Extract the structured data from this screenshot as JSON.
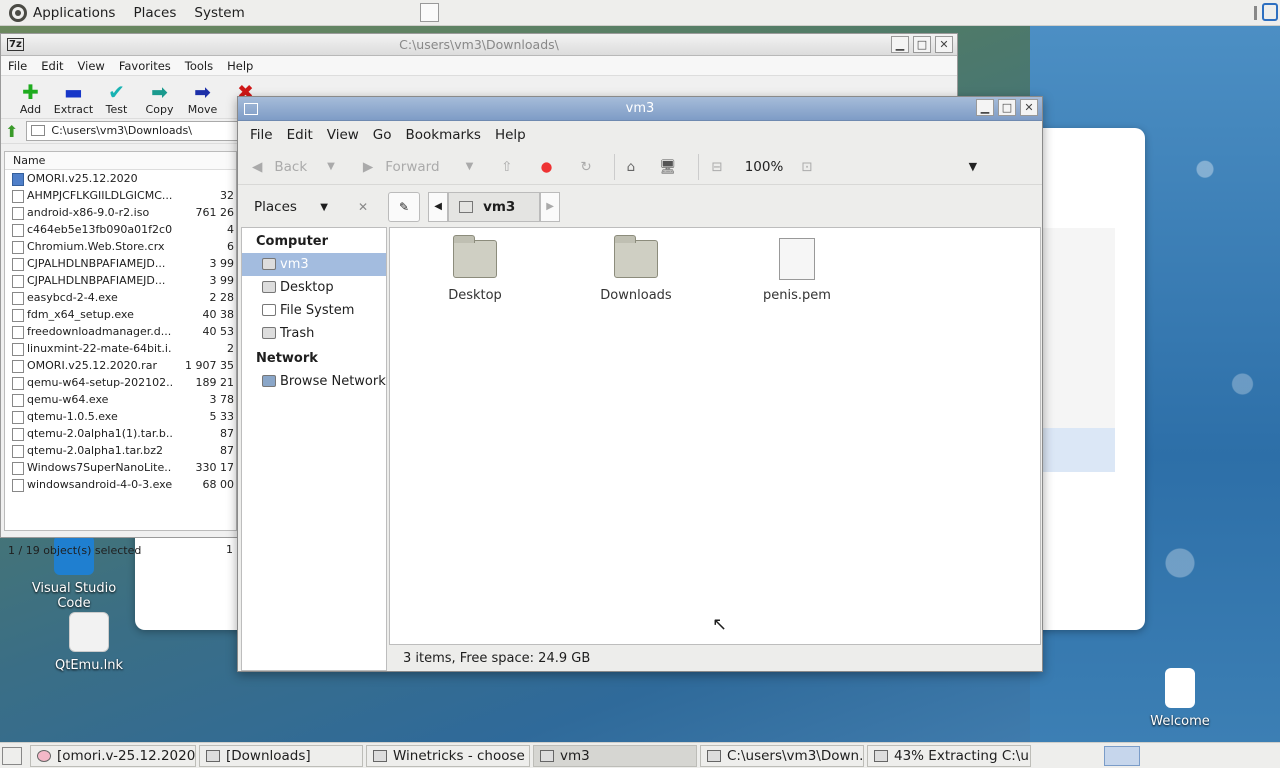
{
  "top_panel": {
    "menus": [
      "Applications",
      "Places",
      "System"
    ]
  },
  "desktop": {
    "icons": [
      {
        "label": "Visual Studio Code"
      },
      {
        "label": "QtEmu.lnk"
      },
      {
        "label": "Welcome"
      }
    ]
  },
  "zip": {
    "title": "C:\\users\\vm3\\Downloads\\",
    "menu": [
      "File",
      "Edit",
      "View",
      "Favorites",
      "Tools",
      "Help"
    ],
    "tools": [
      {
        "label": "Add",
        "glyph": "✚",
        "color": "#1eab1e"
      },
      {
        "label": "Extract",
        "glyph": "▬",
        "color": "#1636c8"
      },
      {
        "label": "Test",
        "glyph": "✔",
        "color": "#19b3b3"
      },
      {
        "label": "Copy",
        "glyph": "➡",
        "color": "#1a9a8e"
      },
      {
        "label": "Move",
        "glyph": "➡",
        "color": "#1c2fa8"
      },
      {
        "label": "De",
        "glyph": "✖",
        "color": "#d01818"
      }
    ],
    "address": "C:\\users\\vm3\\Downloads\\",
    "column_name": "Name",
    "files": [
      {
        "name": "OMORI.v25.12.2020",
        "size": ""
      },
      {
        "name": "AHMPJCFLKGIILDLGICMC...",
        "size": "32"
      },
      {
        "name": "android-x86-9.0-r2.iso",
        "size": "761 26"
      },
      {
        "name": "c464eb5e13fb090a01f2c0...",
        "size": "4"
      },
      {
        "name": "Chromium.Web.Store.crx",
        "size": "6"
      },
      {
        "name": "CJPALHDLNBPAFIAMEJD...",
        "size": "3 99"
      },
      {
        "name": "CJPALHDLNBPAFIAMEJD...",
        "size": "3 99"
      },
      {
        "name": "easybcd-2-4.exe",
        "size": "2 28"
      },
      {
        "name": "fdm_x64_setup.exe",
        "size": "40 38"
      },
      {
        "name": "freedownloadmanager.d...",
        "size": "40 53"
      },
      {
        "name": "linuxmint-22-mate-64bit.i...",
        "size": "2"
      },
      {
        "name": "OMORI.v25.12.2020.rar",
        "size": "1 907 35"
      },
      {
        "name": "qemu-w64-setup-202102...",
        "size": "189 21"
      },
      {
        "name": "qemu-w64.exe",
        "size": "3 78"
      },
      {
        "name": "qtemu-1.0.5.exe",
        "size": "5 33"
      },
      {
        "name": "qtemu-2.0alpha1(1).tar.b...",
        "size": "87"
      },
      {
        "name": "qtemu-2.0alpha1.tar.bz2",
        "size": "87"
      },
      {
        "name": "Windows7SuperNanoLite...",
        "size": "330 17"
      },
      {
        "name": "windowsandroid-4-0-3.exe",
        "size": "68 00"
      }
    ],
    "status": "1 / 19 object(s) selected",
    "status2": "1"
  },
  "nautilus": {
    "title": "vm3",
    "menu": [
      "File",
      "Edit",
      "View",
      "Go",
      "Bookmarks",
      "Help"
    ],
    "back": "Back",
    "forward": "Forward",
    "zoom": "100%",
    "places_label": "Places",
    "path_button": "vm3",
    "sections": {
      "computer": "Computer",
      "network": "Network"
    },
    "places": [
      "vm3",
      "Desktop",
      "File System",
      "Trash"
    ],
    "network_items": [
      "Browse Network"
    ],
    "items": [
      "Desktop",
      "Downloads",
      "penis.pem"
    ],
    "status": "3 items, Free space: 24.9 GB"
  },
  "taskbar": [
    "[omori.v-25.12.2020...",
    "[Downloads]",
    "Winetricks - choose ...",
    "vm3",
    "C:\\users\\vm3\\Down...",
    "43% Extracting C:\\u..."
  ]
}
